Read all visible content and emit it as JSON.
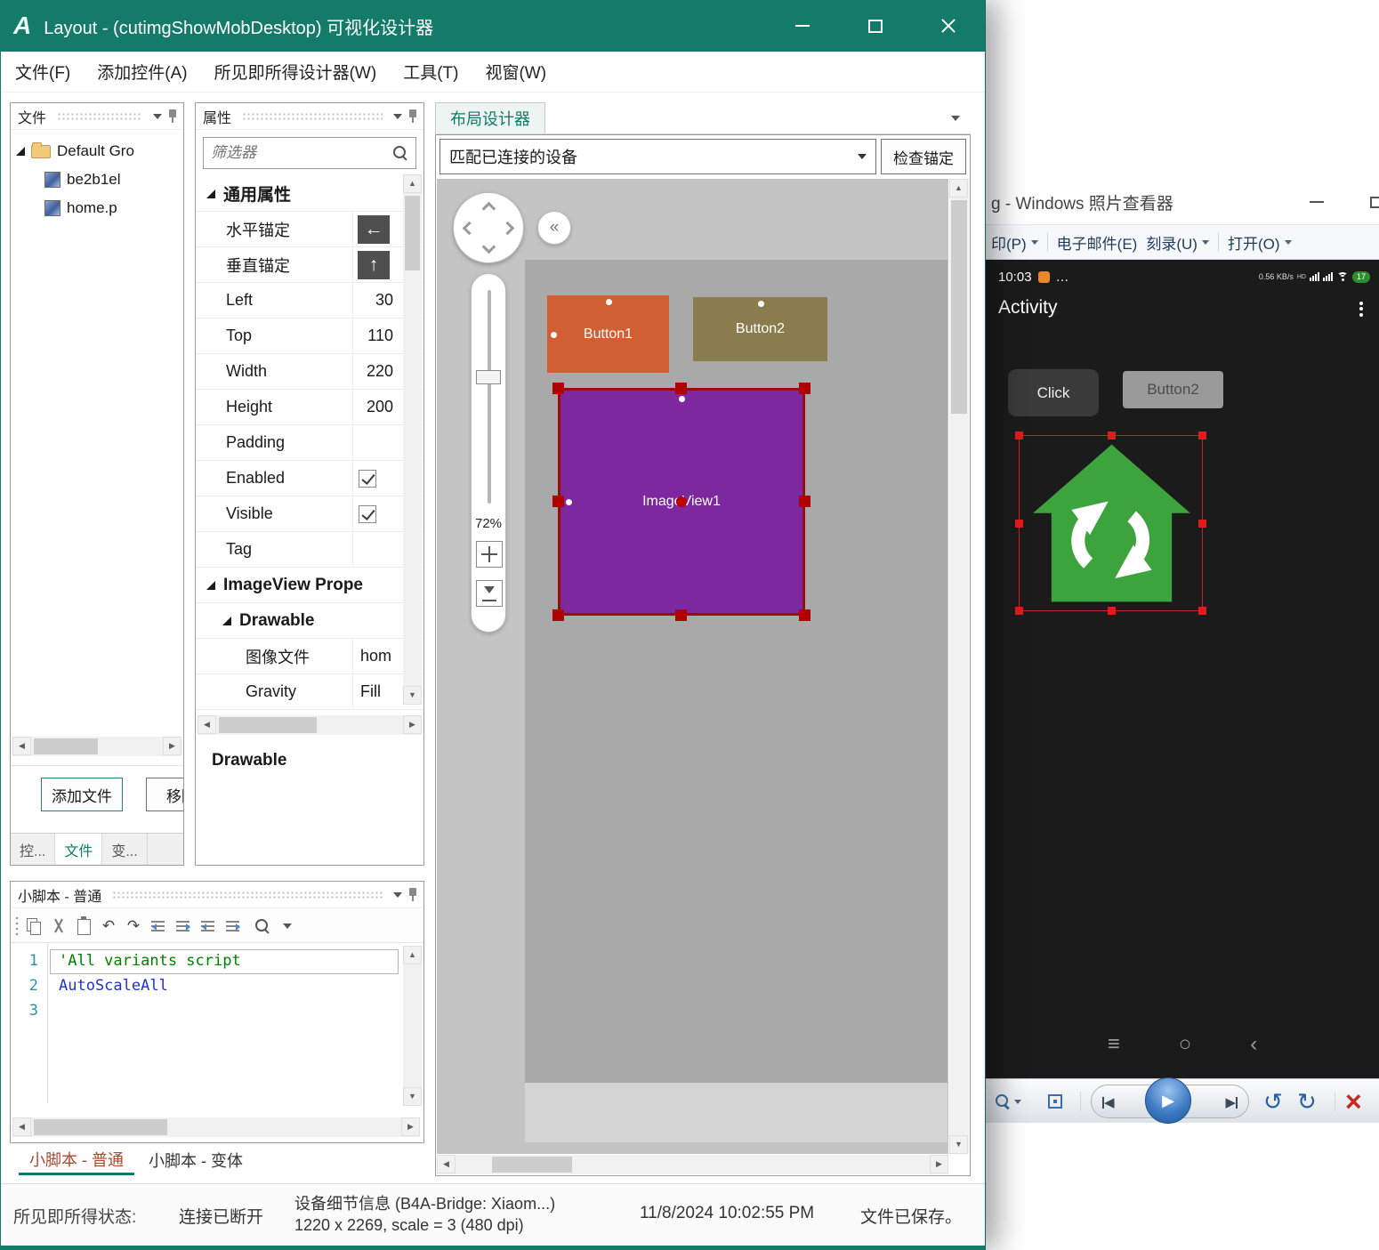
{
  "colors": {
    "titlebar_teal": "#147a6a",
    "accent_teal": "#0e7a68",
    "button1_orange": "#d05f33",
    "button2_olive": "#8b7c4e",
    "imageview_purple": "#7d289f",
    "selection_red": "#b00000",
    "comment_green": "#008000",
    "keyword_blue": "#2233cc",
    "home_icon_green": "#3da33d"
  },
  "icons": {
    "h_anchor_arrow": "←",
    "v_anchor_arrow": "↑",
    "collapse_panel": "«",
    "scroll_up": "▲",
    "scroll_down": "▼",
    "scroll_left": "◀",
    "scroll_right": "▶",
    "undo": "↶",
    "redo": "↷",
    "prev": "◀",
    "next": "▶",
    "play": "▶",
    "rotate_ccw": "↺",
    "rotate_cw": "↻",
    "delete_x": "×",
    "nav_menu": "≡",
    "nav_home": "○",
    "nav_back": "‹",
    "ellipsis": "…"
  },
  "window": {
    "title": "Layout - (cutimgShowMobDesktop) 可视化设计器"
  },
  "menubar": {
    "items": [
      "文件(F)",
      "添加控件(A)",
      "所见即所得设计器(W)",
      "工具(T)",
      "视窗(W)"
    ]
  },
  "files_panel": {
    "title": "文件",
    "root": "Default Gro",
    "file1": "be2b1el",
    "file2": "home.p",
    "add_button": "添加文件",
    "remove_button": "移除",
    "tab1": "控...",
    "tab2": "文件",
    "tab3": "变..."
  },
  "props_panel": {
    "title": "属性",
    "filter": "筛选器",
    "general_section": "通用属性",
    "h_anchor": "水平锚定",
    "v_anchor": "垂直锚定",
    "left_label": "Left",
    "left_value": "30",
    "top_label": "Top",
    "top_value": "110",
    "width_label": "Width",
    "width_value": "220",
    "height_label": "Height",
    "height_value": "200",
    "padding_label": "Padding",
    "enabled_label": "Enabled",
    "enabled_checked": true,
    "visible_label": "Visible",
    "visible_checked": true,
    "tag_label": "Tag",
    "imageview_section": "ImageView Prope",
    "drawable_section": "Drawable",
    "image_file_label": "图像文件",
    "image_file_value": "hom",
    "gravity_label": "Gravity",
    "gravity_value": "Fill",
    "footer": "Drawable"
  },
  "designer": {
    "tab": "布局设计器",
    "device_dropdown": "匹配已连接的设备",
    "check_anchors": "检查锚定",
    "zoom": "72%",
    "button1": "Button1",
    "button2": "Button2",
    "imageview": "ImageView1"
  },
  "script_panel": {
    "title": "小脚本 - 普通",
    "ln1": "1",
    "ln2": "2",
    "ln3": "3",
    "line1": "'All variants script",
    "line2": "AutoScaleAll",
    "tab_normal": "小脚本 - 普通",
    "tab_variants": "小脚本 - 变体"
  },
  "status_bar": {
    "state_label": "所见即所得状态:",
    "state_value": "连接已断开",
    "device_line1": "设备细节信息 (B4A-Bridge: Xiaom...)",
    "device_line2": "1220 x 2269, scale = 3 (480 dpi)",
    "datetime": "11/8/2024 10:02:55 PM",
    "saved": "文件已保存。"
  },
  "photo_viewer": {
    "title": "g - Windows 照片查看器",
    "print": "印(P)",
    "email": "电子邮件(E)",
    "burn": "刻录(U)",
    "open": "打开(O)",
    "time": "10:03",
    "net_speed": "0.56 KB/s",
    "hd": "HD",
    "battery_level": "17",
    "activity": "Activity",
    "click_button": "Click",
    "button2": "Button2"
  }
}
